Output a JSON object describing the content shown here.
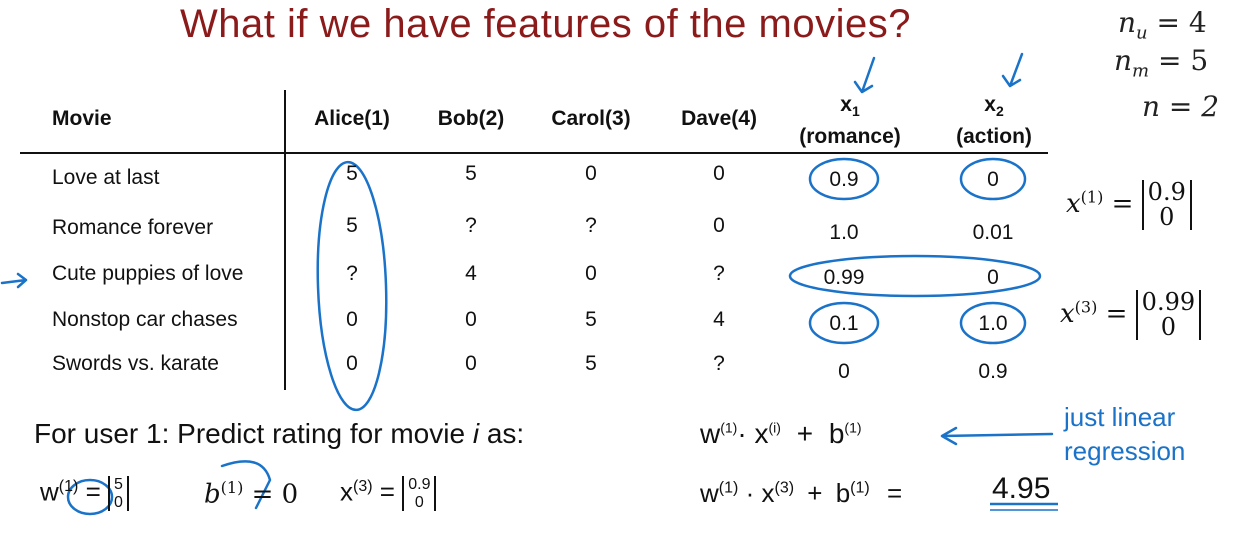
{
  "title": "What if we have features of the movies?",
  "params": {
    "nu": "= 4",
    "nm": "= 5",
    "n": "n = 2"
  },
  "table": {
    "headers": [
      "Movie",
      "Alice(1)",
      "Bob(2)",
      "Carol(3)",
      "Dave(4)"
    ],
    "feature_headers": [
      {
        "symbol": "x",
        "sub": "1",
        "label": "(romance)"
      },
      {
        "symbol": "x",
        "sub": "2",
        "label": "(action)"
      }
    ],
    "rows": [
      {
        "movie": "Love at last",
        "ratings": [
          "5",
          "5",
          "0",
          "0"
        ],
        "x1": "0.9",
        "x2": "0"
      },
      {
        "movie": "Romance forever",
        "ratings": [
          "5",
          "?",
          "?",
          "0"
        ],
        "x1": "1.0",
        "x2": "0.01"
      },
      {
        "movie": "Cute puppies of love",
        "ratings": [
          "?",
          "4",
          "0",
          "?"
        ],
        "x1": "0.99",
        "x2": "0"
      },
      {
        "movie": "Nonstop car chases",
        "ratings": [
          "0",
          "0",
          "5",
          "4"
        ],
        "x1": "0.1",
        "x2": "1.0"
      },
      {
        "movie": "Swords vs. karate",
        "ratings": [
          "0",
          "0",
          "5",
          "?"
        ],
        "x1": "0",
        "x2": "0.9"
      }
    ]
  },
  "side_vectors": {
    "x1": {
      "lhs": "x",
      "sup": "(1)",
      "eq": "=",
      "top": "0.9",
      "bottom": "0"
    },
    "x3": {
      "lhs": "x",
      "sup": "(3)",
      "eq": "=",
      "top": "0.99",
      "bottom": "0"
    }
  },
  "prediction": {
    "label": "For user 1: Predict rating for movie",
    "i": "i",
    "as": "as:",
    "formula": {
      "w": "w",
      "wsup": "(1)",
      "dot": "·",
      "x": "x",
      "xsup": "(i)",
      "plus": "+",
      "b": "b",
      "bsup": "(1)"
    },
    "note_line1": "just linear",
    "note_line2": "regression"
  },
  "bottom": {
    "w": "w",
    "wsup": "(1)",
    "eq": "=",
    "w_top": "5",
    "w_bottom": "0",
    "b": "b",
    "bsup": "(1)",
    "b_eq": "= 0",
    "x": "x",
    "xsup": "(3)",
    "x_eq": "=",
    "x_top": "0.9",
    "x_bottom": "0",
    "calc": "w",
    "calc_wsup": "(1)",
    "calc_dot": "·",
    "calc_x": "x",
    "calc_xsup": "(3)",
    "calc_plus": "+",
    "calc_b": "b",
    "calc_bsup": "(1)",
    "calc_eq": "=",
    "result": "4.95"
  },
  "colors": {
    "title": "#8b1a1a",
    "annotation": "#1a73c8"
  }
}
